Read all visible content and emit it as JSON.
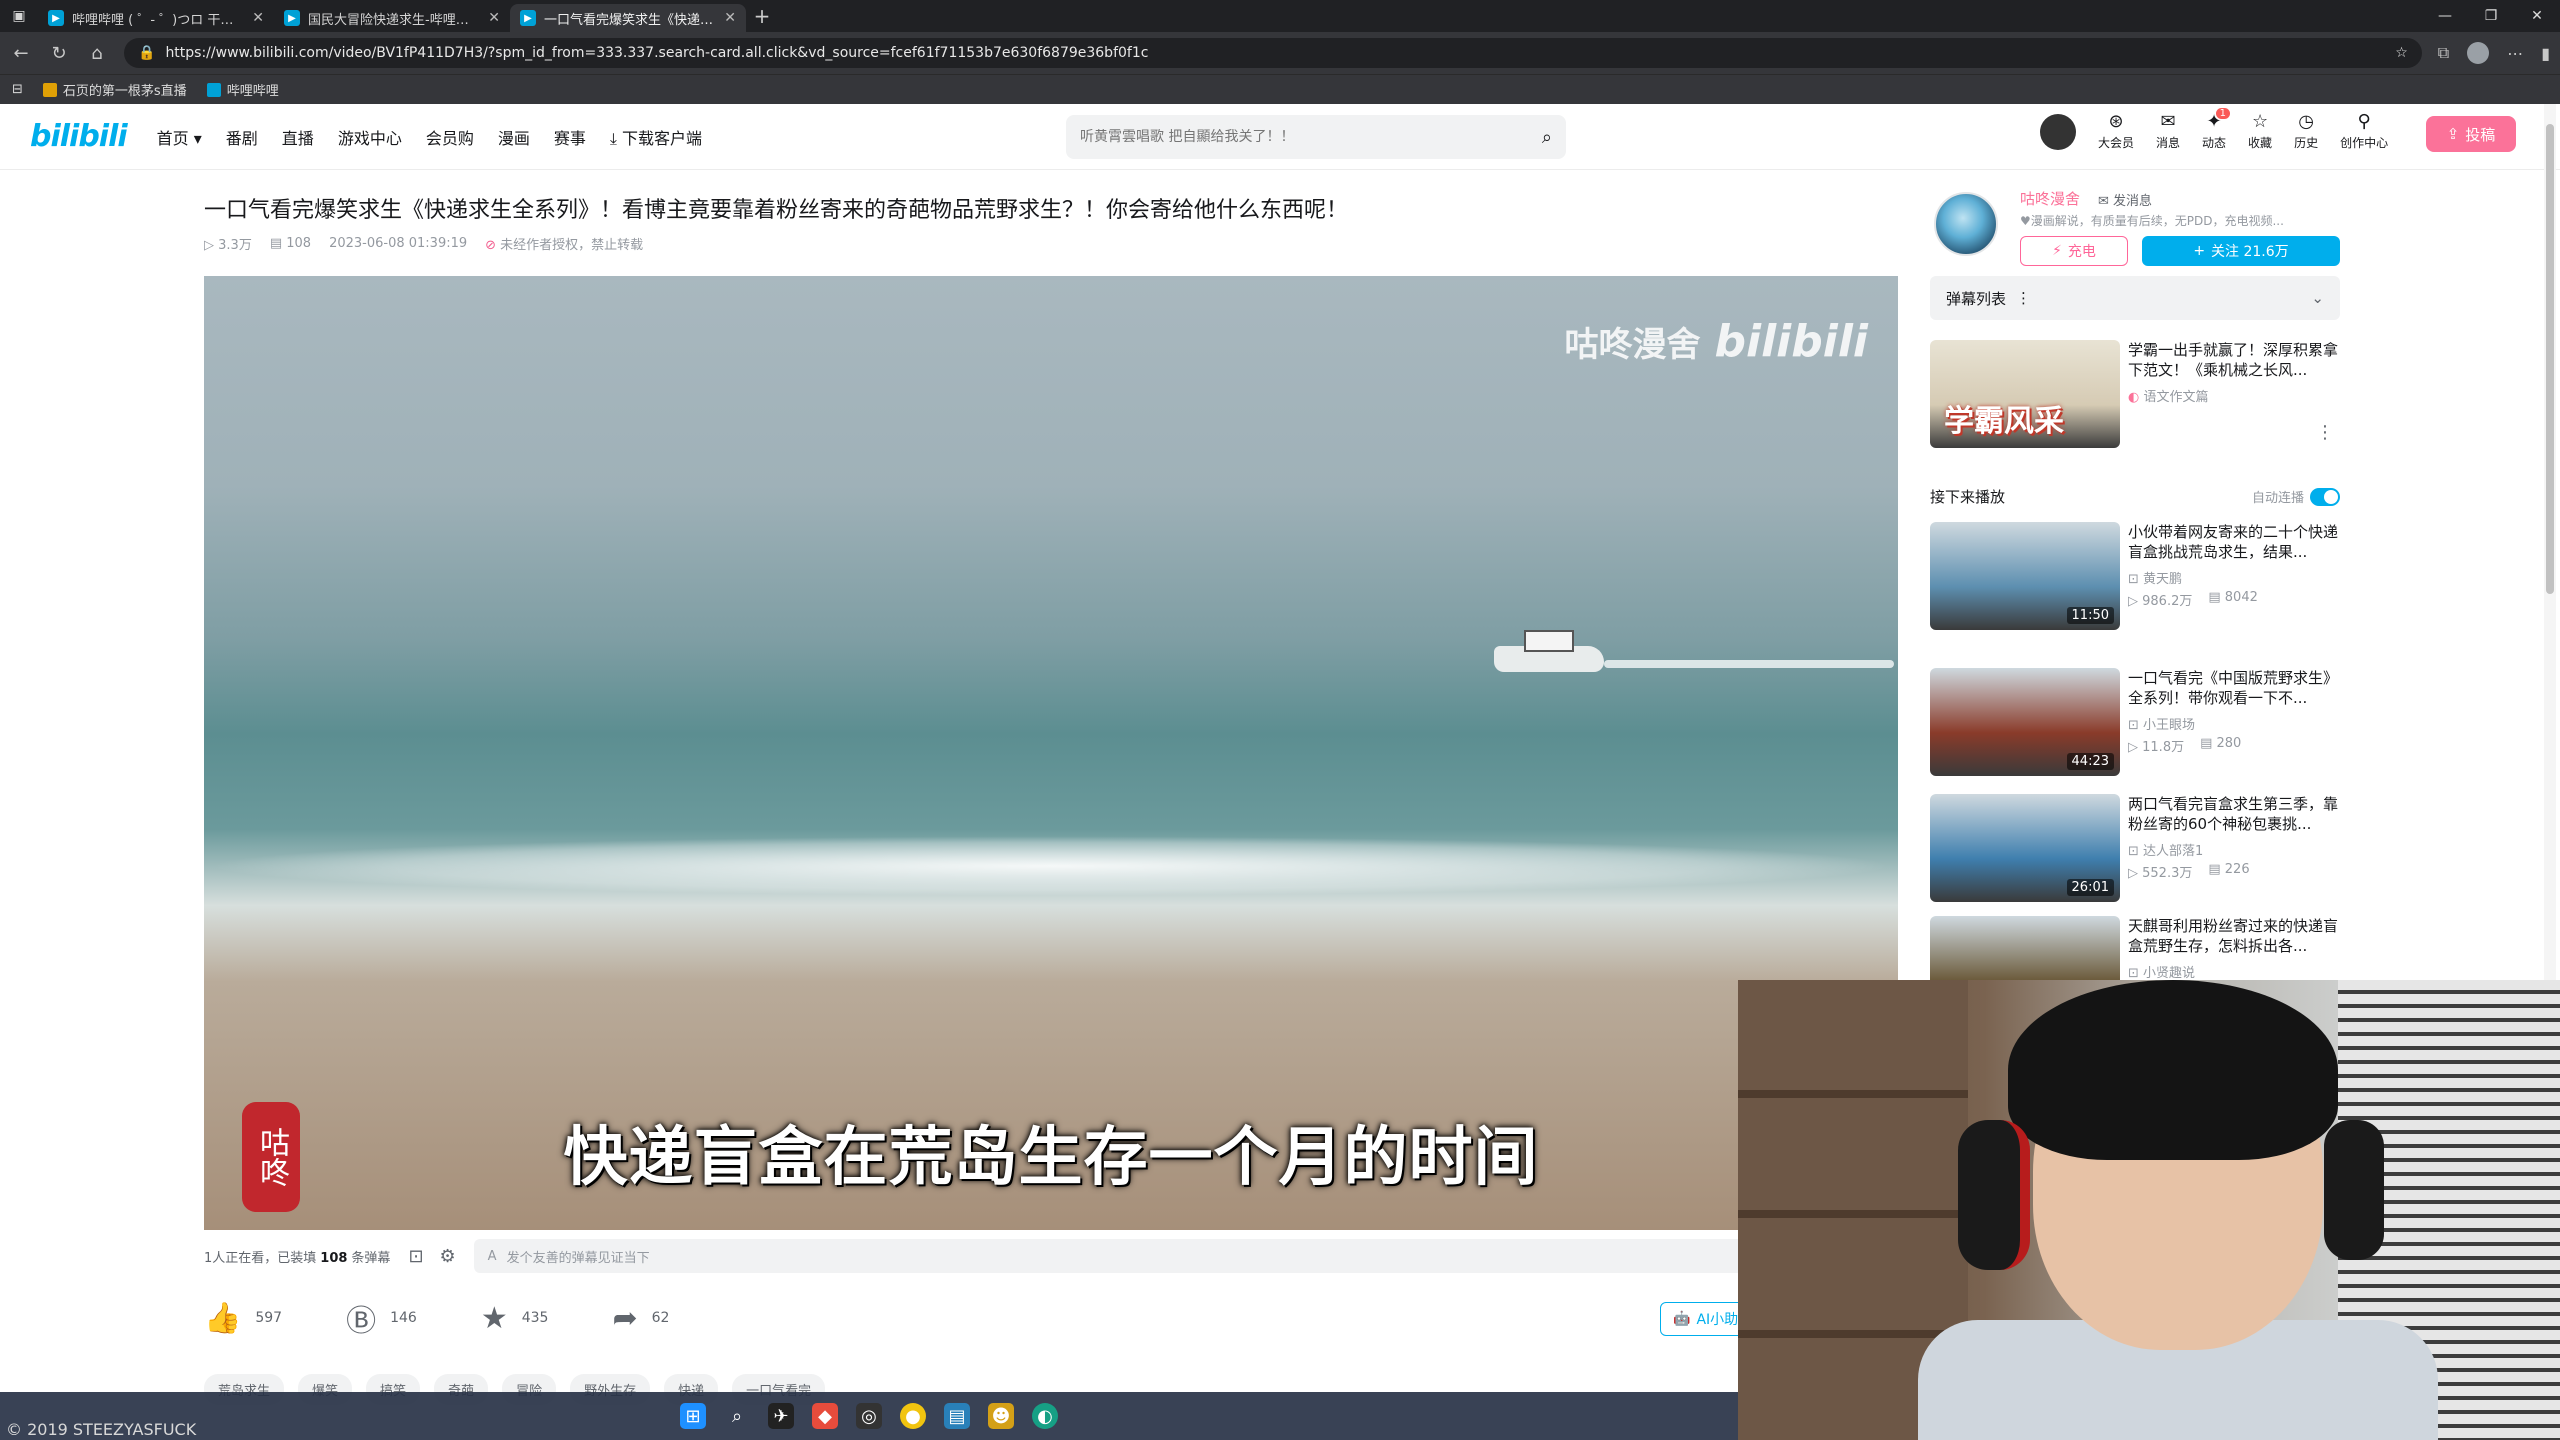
{
  "browser": {
    "tabs": [
      {
        "title": "哔哩哔哩 ( ゜- ゜)つロ 干杯~-bilibili",
        "active": false
      },
      {
        "title": "国民大冒险快递求生-哔哩哔哩_bilibili",
        "active": false
      },
      {
        "title": "一口气看完爆笑求生《快递求生全系列》",
        "active": true
      }
    ],
    "url": "https://www.bilibili.com/video/BV1fP411D7H3/?spm_id_from=333.337.search-card.all.click&vd_source=fcef61f71153b7e630f6879e36bf0f1c",
    "bookmarks": [
      "石页的第一根茅s直播",
      "哔哩哔哩"
    ]
  },
  "header": {
    "logo": "bilibili",
    "nav": [
      "首页 ▾",
      "番剧",
      "直播",
      "游戏中心",
      "会员购",
      "漫画",
      "赛事",
      "⤓ 下载客户端"
    ],
    "search_placeholder": "听黄霄雲唱歌 把自顯给我关了！！",
    "right_items": [
      {
        "label": "大会员",
        "icon": "vip-icon",
        "glyph": "⊛"
      },
      {
        "label": "消息",
        "icon": "mail-icon",
        "glyph": "✉"
      },
      {
        "label": "动态",
        "icon": "dynamic-icon",
        "glyph": "✦",
        "badge": "1"
      },
      {
        "label": "收藏",
        "icon": "star-icon",
        "glyph": "☆"
      },
      {
        "label": "历史",
        "icon": "clock-icon",
        "glyph": "◷"
      },
      {
        "label": "创作中心",
        "icon": "creator-icon",
        "glyph": "⚲"
      }
    ],
    "upload": "投稿"
  },
  "video": {
    "title": "一口气看完爆笑求生《快递求生全系列》！看博主竟要靠着粉丝寄来的奇葩物品荒野求生？！你会寄给他什么东西呢！",
    "views": "3.3万",
    "danmaku": "108",
    "date": "2023-06-08 01:39:19",
    "copyright": "未经作者授权，禁止转载",
    "subtitle": "快递盲盒在荒岛生存一个月的时间",
    "watermark": "咕咚漫舍",
    "watermark_logo": "bilibili",
    "seal": "咕咚"
  },
  "danmaku_bar": {
    "watching_prefix": "1人正在看，已装填",
    "count": "108",
    "watching_suffix": "条弹幕",
    "placeholder": "发个友善的弹幕见证当下"
  },
  "actions": {
    "like": "597",
    "coin": "146",
    "favorite": "435",
    "share": "62",
    "ai": "AI小助"
  },
  "tags": [
    "荒岛求生",
    "爆笑",
    "搞笑",
    "奇葩",
    "冒险",
    "野外生存",
    "快递",
    "一口气看完"
  ],
  "uploader": {
    "name": "咕咚漫舍",
    "message": "发消息",
    "desc": "♥漫画解说，有质量有后续，无PDD，充电视频...",
    "charge": "充电",
    "follow": "关注 21.6万"
  },
  "sidebar": {
    "danmaku_list": "弹幕列表",
    "ad": {
      "title": "学霸一出手就赢了！深厚积累拿下范文！《乘机械之长风...",
      "up": "语文作文篇",
      "thumb_text": "学霸风采"
    },
    "next_label": "接下来播放",
    "autoplay": "自动连播",
    "recs": [
      {
        "title": "小伙带着网友寄来的二十个快递盲盒挑战荒岛求生，结果...",
        "up": "黄天鹏",
        "views": "986.2万",
        "danmaku": "8042",
        "duration": "11:50",
        "thumb": "#5d8fb0"
      },
      {
        "title": "一口气看完《中国版荒野求生》全系列！带你观看一下不...",
        "up": "小王眼场",
        "views": "11.8万",
        "danmaku": "280",
        "duration": "44:23",
        "thumb": "#8a3b2a"
      },
      {
        "title": "两口气看完盲盒求生第三季，靠粉丝寄的60个神秘包裹挑...",
        "up": "达人部落1",
        "views": "552.3万",
        "danmaku": "226",
        "duration": "26:01",
        "thumb": "#3f7fae"
      },
      {
        "title": "天麒哥利用粉丝寄过来的快递盲盒荒野生存，怎料拆出各...",
        "up": "小贤趣说",
        "views": "",
        "danmaku": "",
        "duration": "",
        "thumb": "#6b5a3a"
      }
    ]
  },
  "desktop": {
    "watermark": "© 2019 STEEZYASFUCK"
  }
}
